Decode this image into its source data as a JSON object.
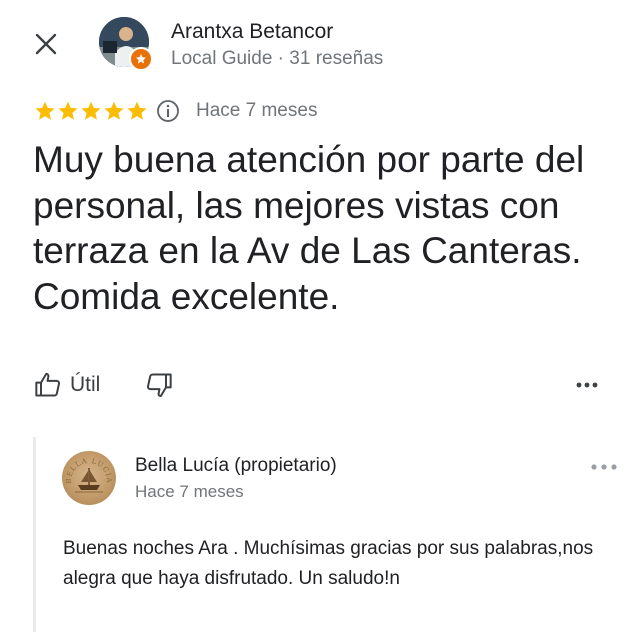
{
  "header": {
    "close_icon": "close-icon",
    "reviewer": {
      "name": "Arantxa Betancor",
      "meta": "Local Guide · 31 reseñas",
      "badge_icon": "local-guide-star-icon",
      "badge_color": "#e8710a"
    }
  },
  "review": {
    "rating": 5,
    "max_rating": 5,
    "star_color": "#fbbc04",
    "info_icon": "info-icon",
    "date": "Hace 7 meses",
    "text": "Muy buena atención por parte del personal, las mejores vistas con terraza en la Av de Las Canteras. Comida excelente."
  },
  "actions": {
    "useful_icon": "thumbs-up-icon",
    "useful_label": "Útil",
    "dislike_icon": "thumbs-down-icon",
    "more_icon": "more-horizontal-icon"
  },
  "owner_reply": {
    "name": "Bella Lucía (propietario)",
    "date": "Hace 7 meses",
    "text": "Buenas noches Ara . Muchísimas gracias por sus palabras,nos alegra que haya disfrutado. Un saludo!n",
    "more_icon": "more-horizontal-icon",
    "logo_text": "BELLA LUCÍA"
  }
}
